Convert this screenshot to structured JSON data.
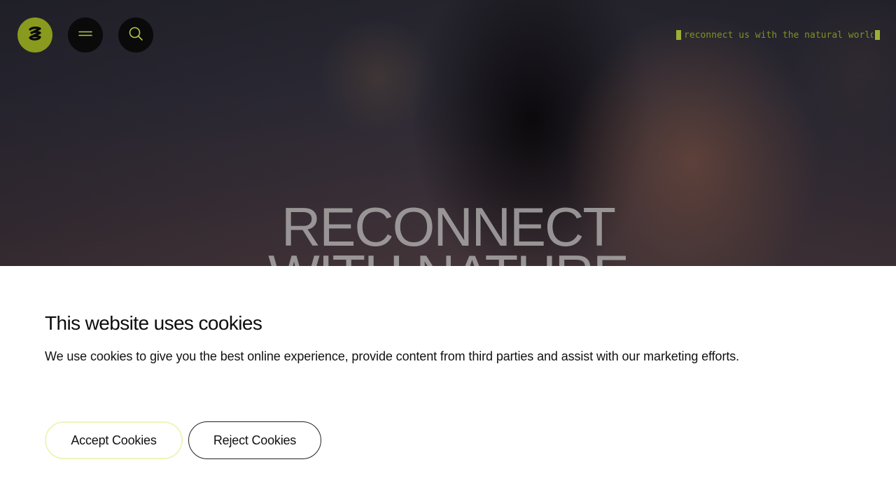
{
  "header": {
    "logo_icon": "brand-logo-icon",
    "menu_icon": "hamburger-menu-icon",
    "search_icon": "search-icon",
    "tagline": "reconnect us with the natural world",
    "accent_color": "#8a9a1e"
  },
  "hero": {
    "title_line1": "RECONNECT",
    "title_line2": "WITH NATURE"
  },
  "cookie_banner": {
    "title": "This website uses cookies",
    "text": "We use cookies to give you the best online experience, provide content from third parties and assist with our marketing efforts.",
    "accept_label": "Accept Cookies",
    "reject_label": "Reject Cookies"
  }
}
